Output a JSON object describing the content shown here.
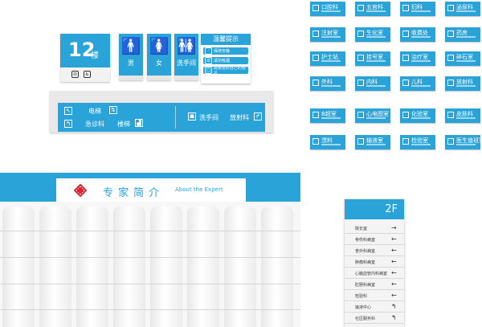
{
  "floor_sign": {
    "number": "12",
    "suffix": "楼",
    "icons": [
      "no-smoking-icon",
      "toilet-icon"
    ]
  },
  "restrooms": [
    {
      "figure": "🚹",
      "label": "男",
      "name": "male"
    },
    {
      "figure": "🚺",
      "label": "女",
      "name": "female"
    },
    {
      "figure": "🚻",
      "label": "洗手间",
      "name": "washroom"
    }
  ],
  "notice": {
    "title": "温馨提示",
    "items": [
      "保持安静",
      "请勿吸烟",
      "请保管好自己的物品"
    ]
  },
  "direction_sign": {
    "elevator": "电梯",
    "emergency": "急诊科",
    "stairs": "楼梯",
    "washroom": "洗手间",
    "radiology": "放射科",
    "elevator_icon": "elevator-icon",
    "stairs_icon": "stairs-icon",
    "toilet_icon": "toilet-icon"
  },
  "plates": [
    [
      "口腔科",
      "五官科",
      "妇科",
      "泌尿科"
    ],
    [
      "注射室",
      "生化室",
      "收费处",
      "药房"
    ],
    [
      "护士站",
      "挂号室",
      "治疗室",
      "碎石室"
    ],
    [
      "外科",
      "内科",
      "儿科",
      "放射科"
    ],
    [
      "B超室",
      "心电图室",
      "化验室",
      "皮肤科"
    ],
    [
      "溃料",
      "输液室",
      "检验室",
      "医生值班室"
    ]
  ],
  "expert": {
    "title": "专家简介",
    "title_en": "About the Expert",
    "logo": "red-cross-logo-icon"
  },
  "directory": {
    "floor": "2F",
    "rows": [
      {
        "name": "院长室",
        "dir": "→"
      },
      {
        "name": "骨伤科病室",
        "dir": "←"
      },
      {
        "name": "普外科病室",
        "dir": "←"
      },
      {
        "name": "肿瘤科病室",
        "dir": "←"
      },
      {
        "name": "心脑血管内科病室",
        "dir": "←"
      },
      {
        "name": "肛肠科病室",
        "dir": "←"
      },
      {
        "name": "检验科",
        "dir": "←"
      },
      {
        "name": "输液中心",
        "dir": "↰"
      },
      {
        "name": "社区服务科",
        "dir": "↰"
      }
    ]
  }
}
